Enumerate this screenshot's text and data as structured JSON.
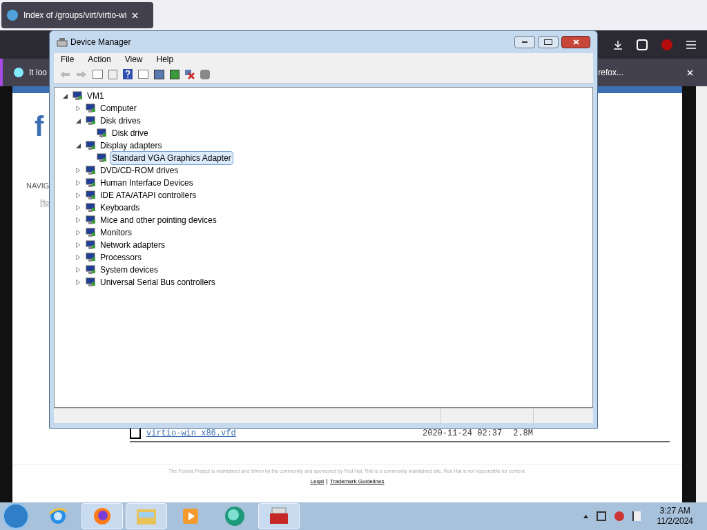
{
  "browser": {
    "tabs": [
      {
        "title": "Index of /groups/virt/virtio-wi",
        "selected": true
      }
    ],
    "notification": {
      "text_start": "It loo",
      "text_end": "refox..."
    },
    "page": {
      "logo": "f",
      "nav_heading": "NAVIG",
      "nav_link": "Ho",
      "file_row": {
        "name": "virtio-win_x86.vfd",
        "date": "2020-11-24 02:37",
        "size": "2.8M"
      },
      "footer": "The Fedora Project is maintained and driven by the community and sponsored by Red Hat. This is a community maintained site. Red Hat is not responsible for content.",
      "footer_links": [
        "Legal",
        "Trademark Guidelines"
      ]
    }
  },
  "window": {
    "title": "Device Manager",
    "menu": [
      "File",
      "Action",
      "View",
      "Help"
    ],
    "tree": {
      "root": "VM1",
      "expanded": true,
      "items": [
        {
          "label": "Computer",
          "expanded": false
        },
        {
          "label": "Disk drives",
          "expanded": true,
          "children": [
            {
              "label": "Disk drive",
              "selected": false
            }
          ]
        },
        {
          "label": "Display adapters",
          "expanded": true,
          "children": [
            {
              "label": "Standard VGA Graphics Adapter",
              "selected": true
            }
          ]
        },
        {
          "label": "DVD/CD-ROM drives",
          "expanded": false
        },
        {
          "label": "Human Interface Devices",
          "expanded": false
        },
        {
          "label": "IDE ATA/ATAPI controllers",
          "expanded": false
        },
        {
          "label": "Keyboards",
          "expanded": false
        },
        {
          "label": "Mice and other pointing devices",
          "expanded": false
        },
        {
          "label": "Monitors",
          "expanded": false
        },
        {
          "label": "Network adapters",
          "expanded": false
        },
        {
          "label": "Processors",
          "expanded": false
        },
        {
          "label": "System devices",
          "expanded": false
        },
        {
          "label": "Universal Serial Bus controllers",
          "expanded": false
        }
      ]
    }
  },
  "taskbar": {
    "apps": [
      {
        "kind": "ie",
        "running": false
      },
      {
        "kind": "firefox",
        "running": true
      },
      {
        "kind": "explorer",
        "running": true
      },
      {
        "kind": "media",
        "running": false
      },
      {
        "kind": "app",
        "running": false
      },
      {
        "kind": "toolbox",
        "running": true
      }
    ],
    "time": "3:27 AM",
    "date": "11/2/2024"
  }
}
